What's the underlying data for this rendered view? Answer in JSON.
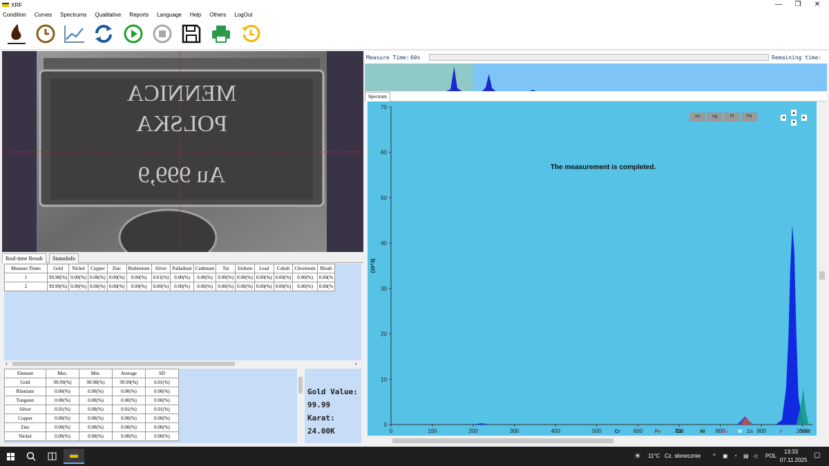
{
  "window": {
    "title": "XRF",
    "minimize": "—",
    "maximize": "❐",
    "close": "✕"
  },
  "menu": [
    "Condition",
    "Curves",
    "Spectrums",
    "Qualitative",
    "Reports",
    "Language",
    "Help",
    "Others",
    "LogOut"
  ],
  "toolbar_icons": [
    "drop-icon",
    "clock-icon",
    "chart-line-icon",
    "refresh-icon",
    "play-icon",
    "stop-icon",
    "save-icon",
    "print-icon",
    "undo-timer-icon"
  ],
  "camera": {
    "line1": "MENNICA",
    "line2": "POLSKA",
    "line3": "Au 999,9"
  },
  "left_tabs": [
    "Real-time Result",
    "StatusInfo"
  ],
  "realtime_table": {
    "headers": [
      "Measure Times",
      "Gold",
      "Nickel",
      "Copper",
      "Zinc",
      "Ruthenium",
      "Silver",
      "Palladium",
      "Cadmium",
      "Tin",
      "Iridium",
      "Lead",
      "Cobalt",
      "Chromium",
      "Rhodi"
    ],
    "rows": [
      [
        "1",
        "99.98(%)",
        "0.00(%)",
        "0.00(%)",
        "0.00(%)",
        "0.00(%)",
        "0.01(%)",
        "0.00(%)",
        "0.00(%)",
        "0.00(%)",
        "0.00(%)",
        "0.00(%)",
        "0.00(%)",
        "0.00(%)",
        "0.00(%"
      ],
      [
        "2",
        "99.99(%)",
        "0.00(%)",
        "0.00(%)",
        "0.00(%)",
        "0.00(%)",
        "0.00(%)",
        "0.00(%)",
        "0.00(%)",
        "0.00(%)",
        "0.00(%)",
        "0.00(%)",
        "0.00(%)",
        "0.00(%)",
        "0.00(%"
      ]
    ]
  },
  "stats_table": {
    "headers": [
      "Element",
      "Max.",
      "Min.",
      "Average",
      "SD"
    ],
    "rows": [
      [
        "Gold",
        "99.99(%)",
        "99.98(%)",
        "99.99(%)",
        "0.01(%)"
      ],
      [
        "Rhenium",
        "0.00(%)",
        "0.00(%)",
        "0.00(%)",
        "0.00(%)"
      ],
      [
        "Tungsten",
        "0.00(%)",
        "0.00(%)",
        "0.00(%)",
        "0.00(%)"
      ],
      [
        "Silver",
        "0.01(%)",
        "0.00(%)",
        "0.01(%)",
        "0.01(%)"
      ],
      [
        "Copper",
        "0.00(%)",
        "0.00(%)",
        "0.00(%)",
        "0.00(%)"
      ],
      [
        "Zinc",
        "0.00(%)",
        "0.00(%)",
        "0.00(%)",
        "0.00(%)"
      ],
      [
        "Nickel",
        "0.00(%)",
        "0.00(%)",
        "0.00(%)",
        "0.00(%)"
      ]
    ]
  },
  "gold_panel": {
    "gold_label": "Gold Value:",
    "gold_value": "99.99",
    "karat_label": "Karat:",
    "karat_value": "24.00K"
  },
  "measure": {
    "label": "Measure Time:",
    "value": "60s",
    "remaining_label": "Remaining time:"
  },
  "spectrum_tab": "Spectrum",
  "element_buttons": [
    "Au",
    "Ag",
    "Pt",
    "Pd"
  ],
  "nav_arrows": {
    "left": "◂",
    "right": "▸",
    "up": "▴",
    "down": "▾"
  },
  "chart_data": {
    "type": "line",
    "message": "The measurement is completed.",
    "ylabel": "(10^3)",
    "xlim": [
      0,
      1024
    ],
    "ylim": [
      0,
      70
    ],
    "x_ticks": [
      "0",
      "100",
      "200",
      "300",
      "400",
      "500",
      "600",
      "700",
      "800",
      "900",
      "1000"
    ],
    "y_ticks": [
      "0",
      "10",
      "20",
      "30",
      "40",
      "50",
      "60",
      "70"
    ],
    "element_markers": [
      {
        "label": "Cr",
        "x": 550,
        "color": "#1a1a6a"
      },
      {
        "label": "Fe",
        "x": 648,
        "color": "#8a3030"
      },
      {
        "label": "Co",
        "x": 700,
        "color": "#1a1a1a"
      },
      {
        "label": "Ni",
        "x": 757,
        "color": "#0a3a0a"
      },
      {
        "label": "Cu",
        "x": 810,
        "color": "#d04090"
      },
      {
        "label": "W",
        "x": 848,
        "color": "#ffffff"
      },
      {
        "label": "Zn",
        "x": 872,
        "color": "#3a3a7a"
      },
      {
        "label": "Ir",
        "x": 948,
        "color": "#6a6aaa"
      },
      {
        "label": "Gold",
        "x": 1005,
        "color": "#3a3a3a"
      }
    ],
    "series": [
      {
        "color": "#0a2adf",
        "points": [
          [
            200,
            0
          ],
          [
            210,
            0.15
          ],
          [
            220,
            0.3
          ],
          [
            230,
            0.15
          ],
          [
            240,
            0
          ]
        ]
      },
      {
        "color": "#2a3ad0",
        "points": [
          [
            840,
            0
          ],
          [
            850,
            0.8
          ],
          [
            860,
            1.8
          ],
          [
            870,
            0.8
          ],
          [
            880,
            0
          ]
        ]
      },
      {
        "color": "#c05050",
        "points": [
          [
            850,
            0
          ],
          [
            858,
            1.3
          ],
          [
            864,
            1.6
          ],
          [
            872,
            0.5
          ],
          [
            878,
            0
          ]
        ]
      },
      {
        "color": "#0a1ae0",
        "points": [
          [
            935,
            0
          ],
          [
            950,
            1
          ],
          [
            960,
            8
          ],
          [
            966,
            20
          ],
          [
            970,
            34
          ],
          [
            975,
            44
          ],
          [
            980,
            38
          ],
          [
            985,
            20
          ],
          [
            990,
            6
          ],
          [
            1000,
            1
          ],
          [
            1010,
            0
          ]
        ]
      },
      {
        "color": "#1a9a8a",
        "points": [
          [
            985,
            0
          ],
          [
            995,
            4
          ],
          [
            1002,
            8
          ],
          [
            1008,
            3
          ],
          [
            1015,
            0
          ]
        ]
      }
    ]
  },
  "mini_chart": {
    "xlim": [
      0,
      1024
    ],
    "ylim": [
      0,
      45
    ],
    "points": [
      [
        0,
        0
      ],
      [
        180,
        0
      ],
      [
        190,
        3
      ],
      [
        198,
        40
      ],
      [
        205,
        5
      ],
      [
        215,
        0
      ],
      [
        260,
        0
      ],
      [
        268,
        6
      ],
      [
        275,
        28
      ],
      [
        282,
        5
      ],
      [
        290,
        0
      ],
      [
        365,
        0
      ],
      [
        372,
        2
      ],
      [
        380,
        0
      ],
      [
        1024,
        0
      ]
    ],
    "highlight_until": 240
  },
  "taskbar": {
    "weather_temp": "11°C",
    "weather_text": "Cz. słonecznie",
    "lang": "POL",
    "time": "13:33",
    "date": "07.11.2025"
  }
}
